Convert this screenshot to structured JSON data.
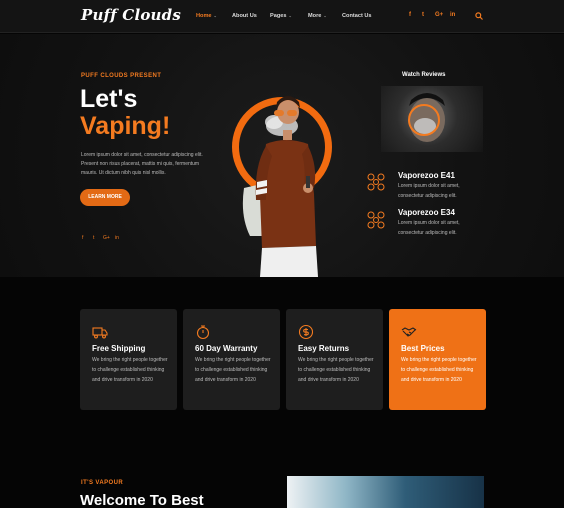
{
  "header": {
    "logo_text": "Puff Clouds",
    "nav": [
      {
        "label": "Home",
        "active": true,
        "has_dropdown": true
      },
      {
        "label": "About Us",
        "active": false,
        "has_dropdown": false
      },
      {
        "label": "Pages",
        "active": false,
        "has_dropdown": true
      },
      {
        "label": "More",
        "active": false,
        "has_dropdown": true
      },
      {
        "label": "Contact Us",
        "active": false,
        "has_dropdown": false
      }
    ],
    "social": [
      {
        "icon": "facebook-icon",
        "glyph": "f"
      },
      {
        "icon": "twitter-icon",
        "glyph": "t"
      },
      {
        "icon": "google-plus-icon",
        "glyph": "G+"
      },
      {
        "icon": "linkedin-icon",
        "glyph": "in"
      }
    ],
    "search_icon": "search-icon"
  },
  "hero": {
    "eyebrow": "PUFF CLOUDS PRESENT",
    "title_line1": "Let's",
    "title_line2": "Vaping!",
    "paragraph": "Lorem ipsum dolor sit amet, consectetur adipiscing elit. Present non risus placerat, mattis mi quis, fermentum mauris. Ut dictum nibh quis nisl mollis.",
    "button_label": "LEARN MORE",
    "social": [
      {
        "icon": "facebook-icon",
        "glyph": "f"
      },
      {
        "icon": "twitter-icon",
        "glyph": "t"
      },
      {
        "icon": "google-plus-icon",
        "glyph": "G+"
      },
      {
        "icon": "linkedin-icon",
        "glyph": "in"
      }
    ]
  },
  "reviews": {
    "title": "Watch Reviews",
    "products": [
      {
        "name": "Vaporezoo E41",
        "desc": "Lorem ipsum dolor sit amet, consectetur adipiscing elit."
      },
      {
        "name": "Vaporezoo E34",
        "desc": "Lorem ipsum dolor sit amet, consectetur adipiscing elit."
      }
    ]
  },
  "features": [
    {
      "icon": "truck-icon",
      "title": "Free Shipping",
      "text": "We bring the right people together to challenge established thinking and drive transform in 2020",
      "highlight": false
    },
    {
      "icon": "stopwatch-icon",
      "title": "60 Day Warranty",
      "text": "We bring the right people together to challenge established thinking and drive transform in 2020",
      "highlight": false
    },
    {
      "icon": "dollar-return-icon",
      "title": "Easy Returns",
      "text": "We bring the right people together to challenge established thinking and drive transform in 2020",
      "highlight": false
    },
    {
      "icon": "handshake-icon",
      "title": "Best Prices",
      "text": "We bring the right people together to challenge established thinking and drive transform in 2020",
      "highlight": true
    }
  ],
  "section2": {
    "eyebrow": "IT'S VAPOUR",
    "title": "Welcome To Best"
  },
  "colors": {
    "accent": "#f47b20",
    "background": "#050505",
    "card": "#1e1e1e"
  }
}
